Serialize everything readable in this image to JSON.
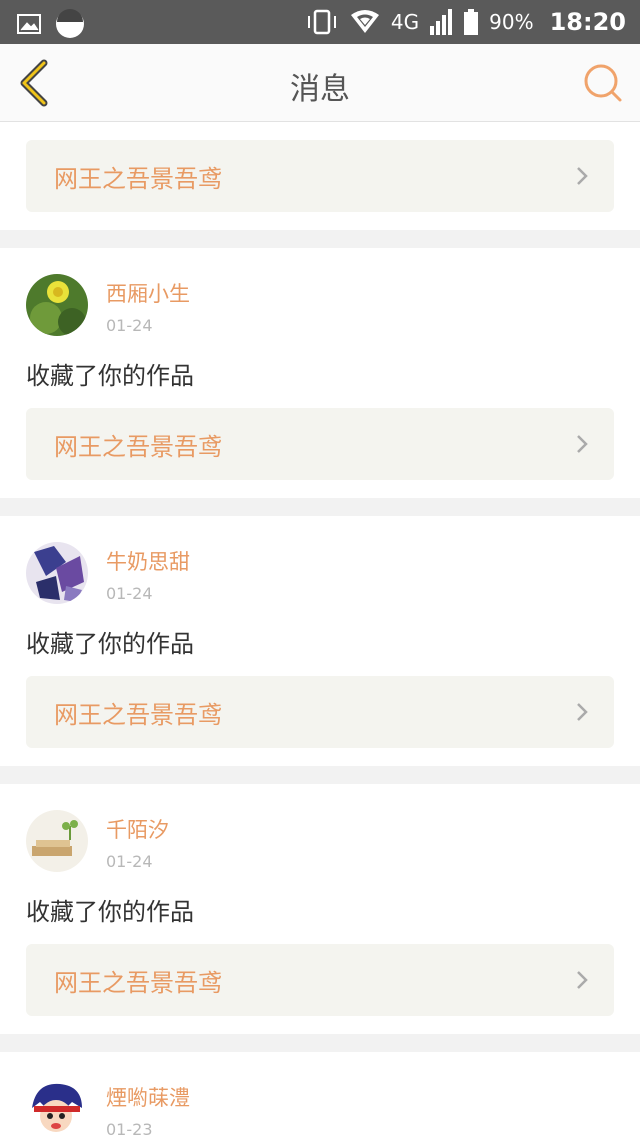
{
  "status_bar": {
    "network": "4G",
    "battery": "90%",
    "time": "18:20",
    "icons": [
      "image-icon",
      "circle-status-icon",
      "vibrate-icon",
      "wifi-icon",
      "signal-icon",
      "battery-icon"
    ]
  },
  "header": {
    "title": "消息",
    "back_icon": "chevron-left-icon",
    "search_icon": "search-icon"
  },
  "top_card": {
    "work_title": "网王之吾景吾鸢"
  },
  "notifications": [
    {
      "user": "西厢小生",
      "date": "01-24",
      "action": "收藏了你的作品",
      "work_title": "网王之吾景吾鸢"
    },
    {
      "user": "牛奶思甜",
      "date": "01-24",
      "action": "收藏了你的作品",
      "work_title": "网王之吾景吾鸢"
    },
    {
      "user": "千陌汐",
      "date": "01-24",
      "action": "收藏了你的作品",
      "work_title": "网王之吾景吾鸢"
    },
    {
      "user": "煙喲菋澧",
      "date": "01-23"
    }
  ],
  "colors": {
    "accent": "#e89a63",
    "status_bar": "#5a5a5a",
    "work_bg": "#f4f4ef"
  }
}
